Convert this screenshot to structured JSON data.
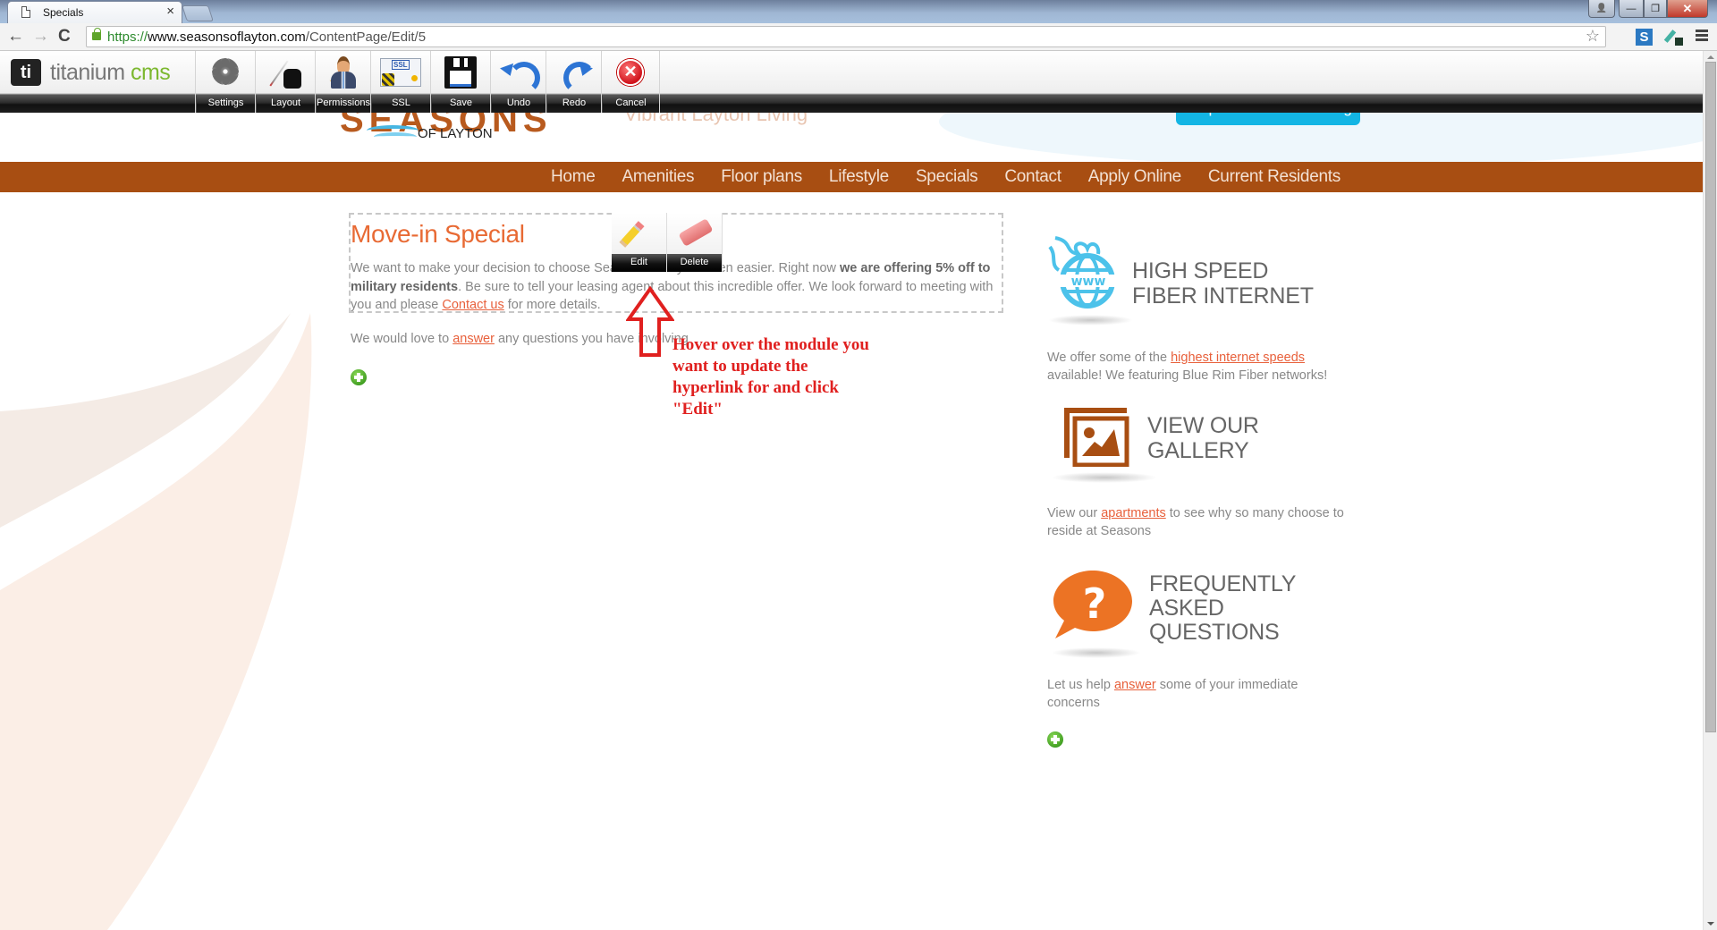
{
  "browser": {
    "tab_title": "Specials",
    "tab_close": "×",
    "url_scheme": "https://",
    "url_host": "www.seasonsoflayton.com",
    "url_path": "/ContentPage/Edit/5",
    "icons": {
      "back": "←",
      "forward": "→",
      "reload": "C",
      "star": "☆",
      "ext_s": "S",
      "win_user": "👤",
      "win_min": "—",
      "win_max": "❐",
      "win_close": "✕"
    }
  },
  "cms_toolbar": {
    "logo_mark": "ti",
    "logo_text": "titanium ",
    "logo_accent": "cms",
    "buttons": [
      {
        "label": "Settings",
        "icon": "gear-icon"
      },
      {
        "label": "Layout",
        "icon": "inkwell-pen-icon"
      },
      {
        "label": "Permissions",
        "icon": "user-permissions-icon"
      },
      {
        "label": "SSL",
        "icon": "ssl-certificate-icon"
      },
      {
        "label": "Save",
        "icon": "floppy-disk-icon"
      },
      {
        "label": "Undo",
        "icon": "undo-arrow-icon"
      },
      {
        "label": "Redo",
        "icon": "redo-arrow-icon"
      },
      {
        "label": "Cancel",
        "icon": "cancel-x-icon"
      }
    ],
    "cancel_glyph": "✕"
  },
  "site": {
    "logo_main": "SEASONS",
    "logo_sub": "OF LAYTON",
    "tagline": "Vibrant Layton Living",
    "request_button": "Request a Tour & Pricing",
    "nav": [
      "Home",
      "Amenities",
      "Floor plans",
      "Lifestyle",
      "Specials",
      "Contact",
      "Apply Online",
      "Current Residents"
    ],
    "colors": {
      "nav_bg": "#a84e12",
      "heading_accent": "#e86a34",
      "link": "#e8603b",
      "request_btn": "#13b5e4"
    }
  },
  "main": {
    "module": {
      "title": "Move-in Special",
      "p1_a": "We want to make your decision to choose Seasons of Layton even easier.  Right now ",
      "p1_bold": "we are offering 5% off to military residents",
      "p1_b": ". Be sure to tell your leasing agent about this incredible offer.  We look forward to meeting with you and please  ",
      "p1_link": "Contact us",
      "p1_c": " for more details."
    },
    "hover_tools": {
      "edit": "Edit",
      "delete": "Delete"
    },
    "para2_a": "We would love to ",
    "para2_link": "answer",
    "para2_b": " any questions you have involving"
  },
  "annotation": {
    "text": "Hover over the module you want to update the hyperlink for and click \"Edit\""
  },
  "sidebar": {
    "blocks": [
      {
        "heading_l1": "HIGH SPEED",
        "heading_l2": "FIBER INTERNET",
        "text_a": "We offer some of the ",
        "link": "highest internet speeds",
        "text_b": " available! We featuring Blue Rim Fiber networks!"
      },
      {
        "heading_l1": "VIEW OUR",
        "heading_l2": "GALLERY",
        "text_a": "View our ",
        "link": "apartments",
        "text_b": " to see why so many choose to reside at Seasons"
      },
      {
        "heading_l1": "FREQUENTLY",
        "heading_l2": "ASKED",
        "heading_l3": "QUESTIONS",
        "text_a": "Let us help ",
        "link": "answer",
        "text_b": " some of your immediate concerns"
      }
    ]
  }
}
